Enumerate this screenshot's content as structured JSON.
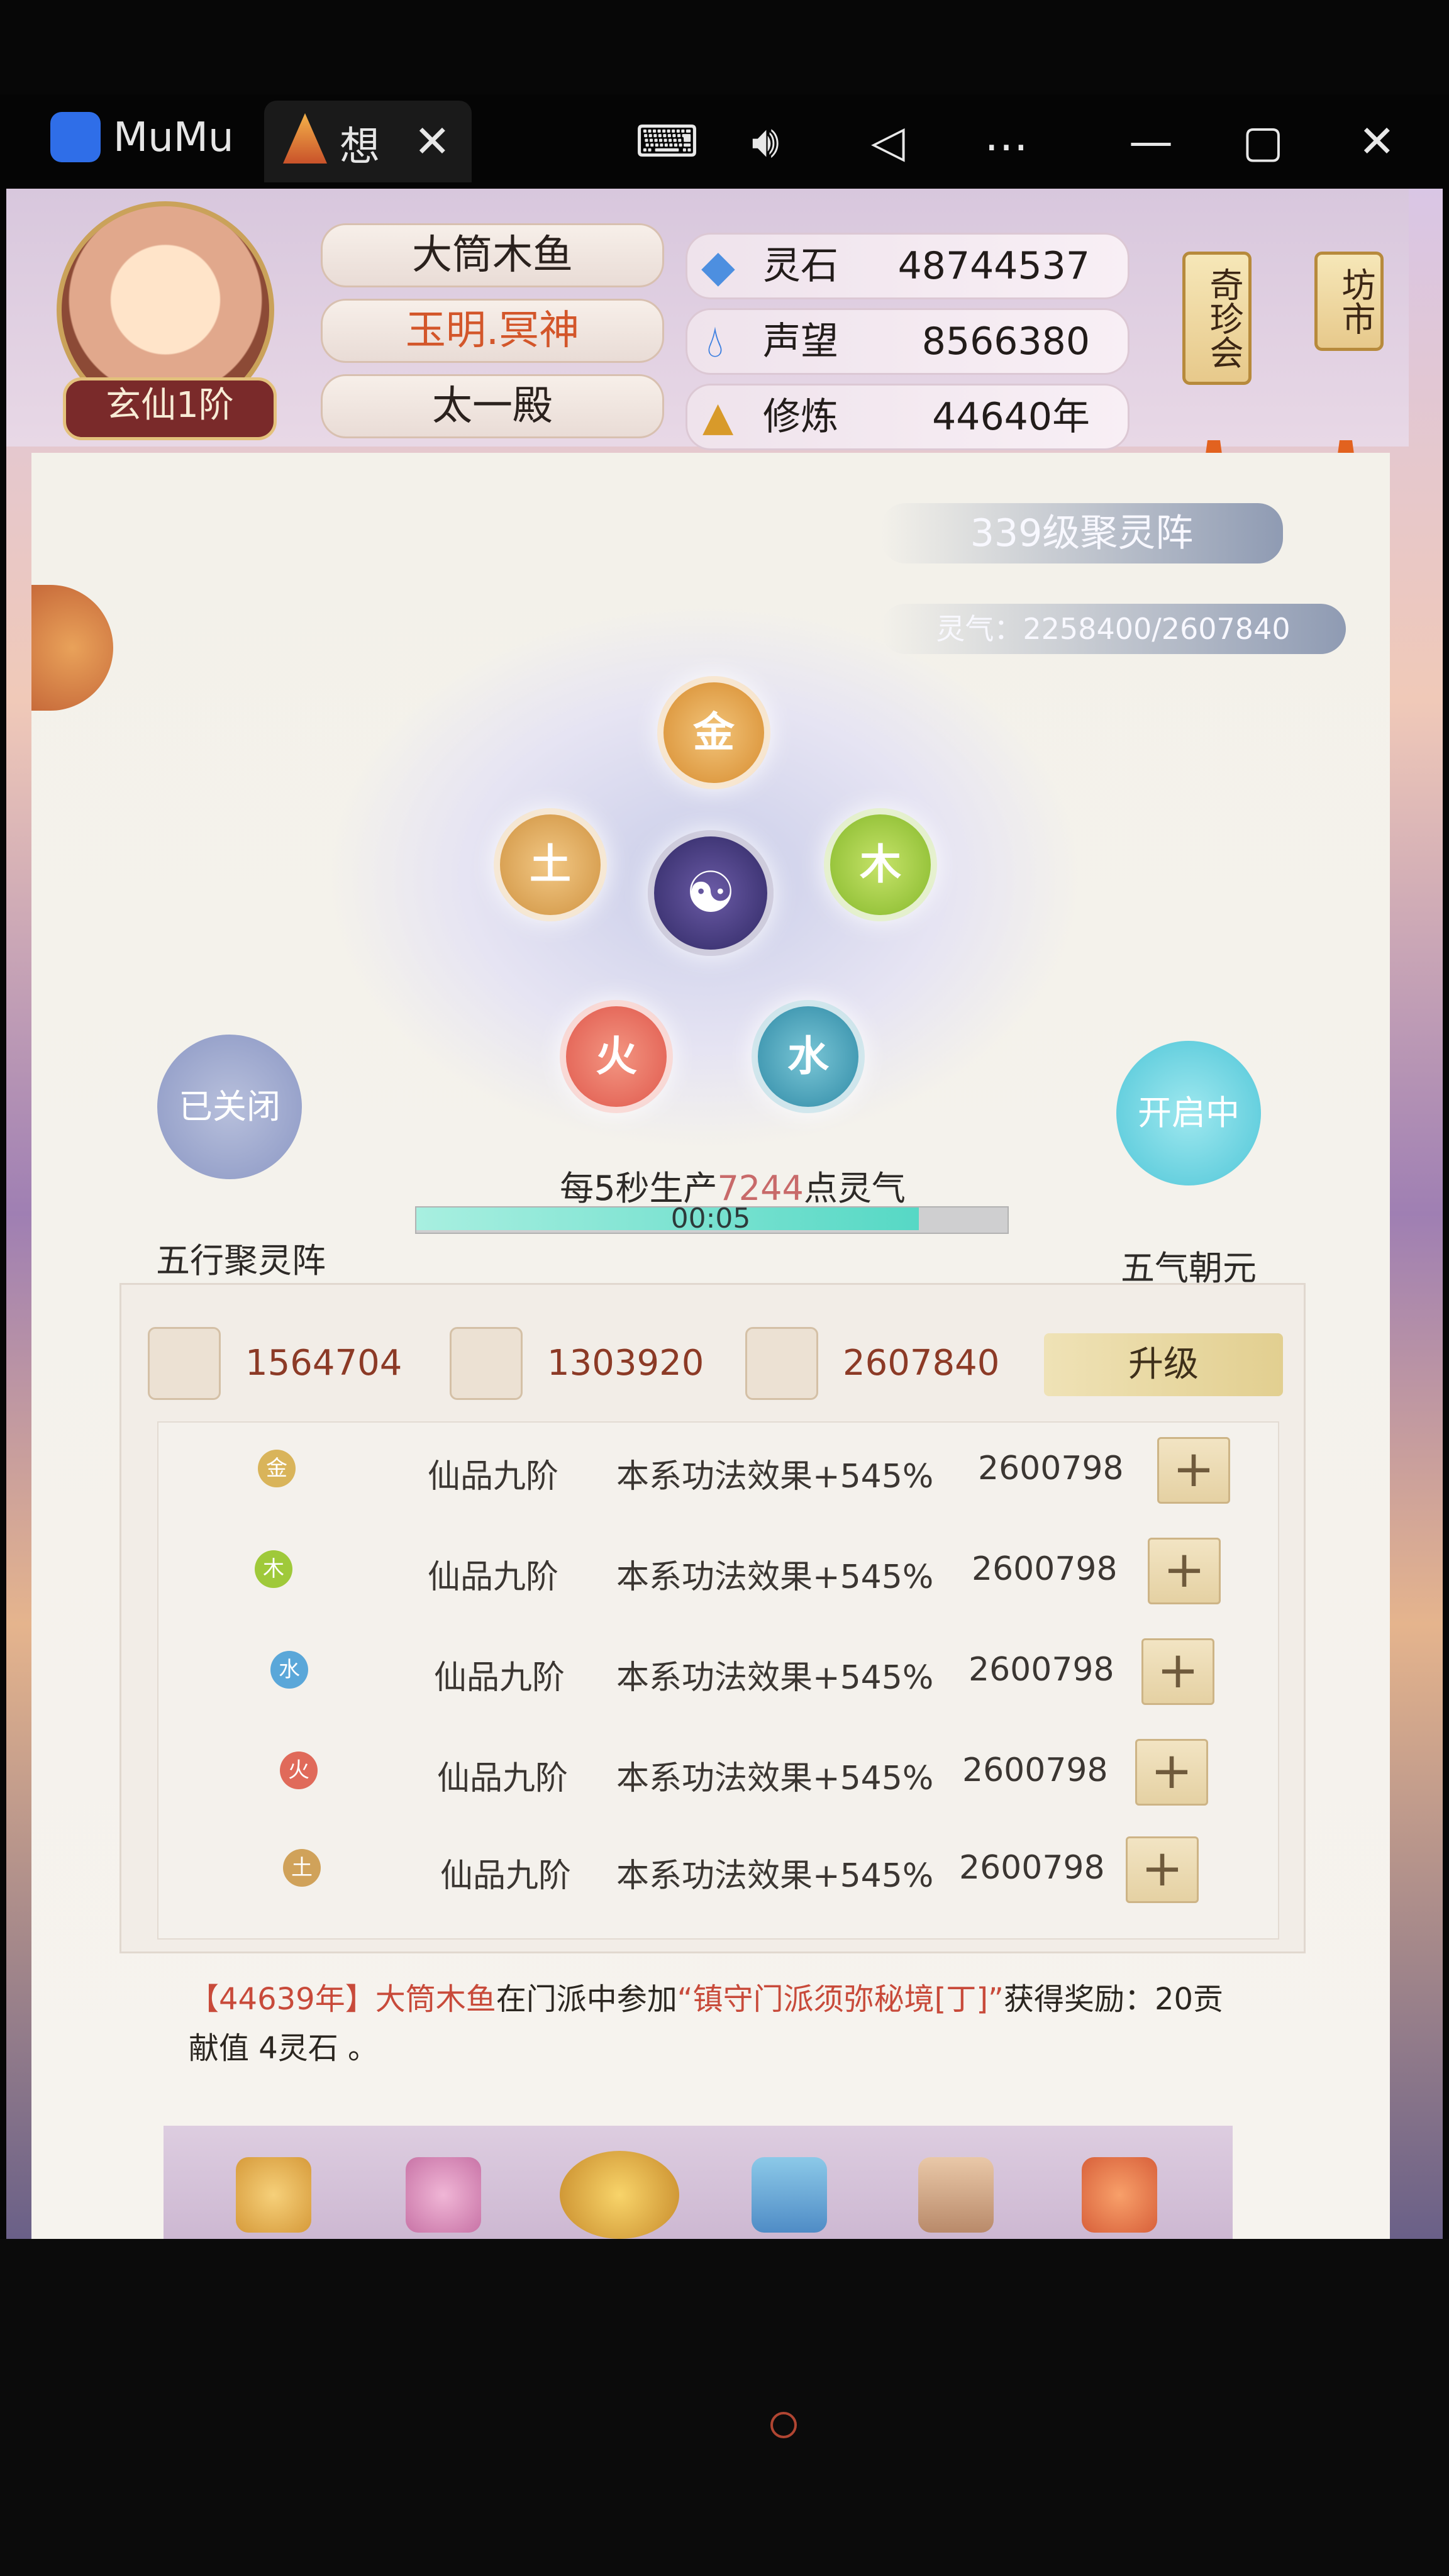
{
  "window": {
    "app_name": "MuMu",
    "tab_title": "想",
    "icons": [
      "keyboard-icon",
      "volume-icon",
      "back-icon",
      "more-icon",
      "minimize-icon",
      "maximize-icon",
      "close-icon"
    ]
  },
  "player": {
    "name": "大筒木鱼",
    "title": "玉明.冥神",
    "sect": "太一殿",
    "rank": "玄仙1阶"
  },
  "stats": [
    {
      "label": "灵石",
      "value": "48744537"
    },
    {
      "label": "声望",
      "value": "8566380"
    },
    {
      "label": "修炼",
      "value": "44640年"
    }
  ],
  "side_buttons": {
    "left": "奇珍会",
    "right": "坊市"
  },
  "array": {
    "level": "339级聚灵阵",
    "qi": "灵气：2258400/2607840",
    "elements": [
      "金",
      "木",
      "水",
      "火",
      "土"
    ],
    "production_prefix": "每5秒生产",
    "production_value": "7244",
    "production_suffix": "点灵气",
    "timer": "00:05",
    "progress": 0.85
  },
  "toggles": {
    "left_state": "已关闭",
    "left_caption": "五行聚灵阵",
    "right_state": "开启中",
    "right_caption": "五气朝元"
  },
  "resources": [
    {
      "icon": "scroll-icon",
      "value": "1564704"
    },
    {
      "icon": "book-icon",
      "value": "1303920"
    },
    {
      "icon": "herb-icon",
      "value": "2607840"
    }
  ],
  "upgrade_label": "升级",
  "element_rows": [
    {
      "element": "金",
      "grade": "仙品九阶",
      "effect": "本系功法效果+545%",
      "value": "2600798",
      "color": "#d9b45a"
    },
    {
      "element": "木",
      "grade": "仙品九阶",
      "effect": "本系功法效果+545%",
      "value": "2600798",
      "color": "#9fc93a"
    },
    {
      "element": "水",
      "grade": "仙品九阶",
      "effect": "本系功法效果+545%",
      "value": "2600798",
      "color": "#5aa7d9"
    },
    {
      "element": "火",
      "grade": "仙品九阶",
      "effect": "本系功法效果+545%",
      "value": "2600798",
      "color": "#e06a5a"
    },
    {
      "element": "土",
      "grade": "仙品九阶",
      "effect": "本系功法效果+545%",
      "value": "2600798",
      "color": "#d0a25a"
    }
  ],
  "log": {
    "year": "【44639年】",
    "name": "大筒木鱼",
    "mid": "在门派中参加",
    "event": "“镇守门派须弥秘境[丁]”",
    "end": "获得奖励：20贡献值 4灵石 。"
  },
  "bottom_icons": [
    "bottom-icon-1",
    "bottom-icon-2",
    "bottom-icon-3",
    "bottom-icon-4",
    "bottom-icon-5",
    "bottom-icon-6"
  ]
}
